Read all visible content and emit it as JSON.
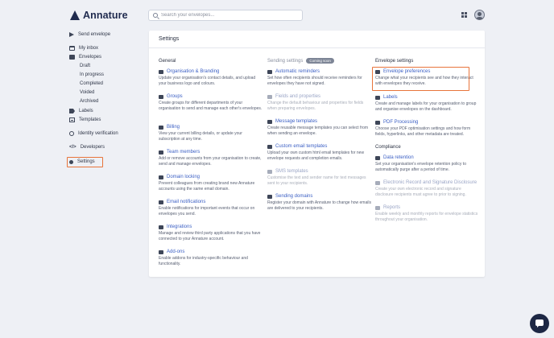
{
  "app": {
    "brand": "Annature"
  },
  "search": {
    "placeholder": "Search your envelopes..."
  },
  "sidebar": {
    "send_envelope": "Send envelope",
    "my_inbox": "My inbox",
    "envelopes": "Envelopes",
    "sub": [
      "Draft",
      "In progress",
      "Completed",
      "Voided",
      "Archived"
    ],
    "labels": "Labels",
    "templates": "Templates",
    "identity": "Identity verification",
    "developers": "Developers",
    "settings": "Settings"
  },
  "page": {
    "title": "Settings"
  },
  "general": {
    "heading": "General",
    "items": [
      {
        "title": "Organisation & Branding",
        "desc": "Update your organisation's contact details, and upload your business logo and colours."
      },
      {
        "title": "Groups",
        "desc": "Create groups for different departments of your organisation to send and manage each other's envelopes."
      },
      {
        "title": "Billing",
        "desc": "View your current billing details, or update your subscription at any time."
      },
      {
        "title": "Team members",
        "desc": "Add or remove accounts from your organisation to create, send and manage envelopes."
      },
      {
        "title": "Domain locking",
        "desc": "Prevent colleagues from creating brand new Annature accounts using the same email domain."
      },
      {
        "title": "Email notifications",
        "desc": "Enable notifications for important events that occur on envelopes you send."
      },
      {
        "title": "Integrations",
        "desc": "Manage and review third party applications that you have connected to your Annature account."
      },
      {
        "title": "Add-ons",
        "desc": "Enable addons for industry-specific behaviour and functionality."
      }
    ]
  },
  "sending": {
    "heading": "Sending settings",
    "badge": "Coming soon",
    "items": [
      {
        "title": "Automatic reminders",
        "desc": "Set how often recipients should receive reminders for envelopes they have not signed."
      },
      {
        "title": "Fields and properties",
        "desc": "Change the default behaviour and properties for fields when preparing envelopes."
      },
      {
        "title": "Message templates",
        "desc": "Create reusable message templates you can select from when sending an envelope."
      },
      {
        "title": "Custom email templates",
        "desc": "Upload your own custom html email templates for new envelope requests and completion emails."
      },
      {
        "title": "SMS templates",
        "desc": "Customise the text and sender name for text messages sent to your recipients."
      },
      {
        "title": "Sending domains",
        "desc": "Register your domain with Annature to change how emails are delivered to your recipients."
      }
    ]
  },
  "envelope": {
    "heading": "Envelope settings",
    "items": [
      {
        "title": "Envelope preferences",
        "desc": "Change what your recipients see and how they interact with envelopes they receive."
      },
      {
        "title": "Labels",
        "desc": "Create and manage labels for your organisation to group and organise envelopes on the dashboard."
      },
      {
        "title": "PDF Processing",
        "desc": "Choose your PDF optimisation settings and how form fields, hyperlinks, and other metadata are treated."
      }
    ]
  },
  "compliance": {
    "heading": "Compliance",
    "items": [
      {
        "title": "Data retention",
        "desc": "Set your organisation's envelope retention policy to automatically purge after a period of time."
      },
      {
        "title": "Electronic Record and Signature Disclosure",
        "desc": "Create your own electronic record and signature disclosure recipients must agree to prior to signing."
      },
      {
        "title": "Reports",
        "desc": "Enable weekly and monthly reports for envelope statistics throughout your organisation."
      }
    ]
  }
}
